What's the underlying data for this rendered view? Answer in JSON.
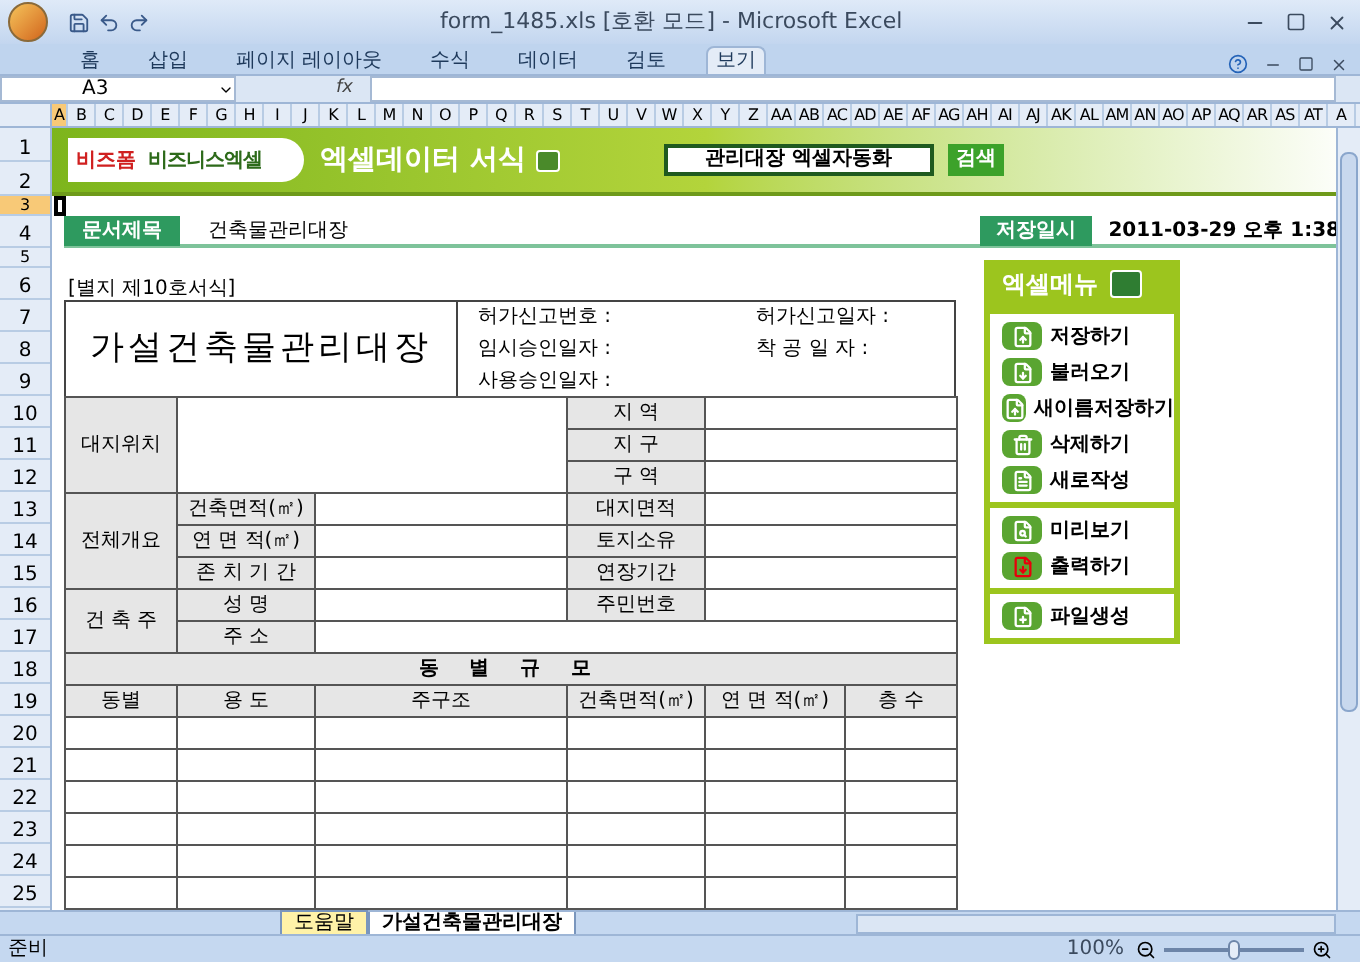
{
  "window": {
    "title": "form_1485.xls  [호환 모드] - Microsoft Excel"
  },
  "ribbon_tabs": [
    {
      "label": "홈",
      "selected": false
    },
    {
      "label": "삽입",
      "selected": false
    },
    {
      "label": "페이지 레이아웃",
      "selected": false
    },
    {
      "label": "수식",
      "selected": false
    },
    {
      "label": "데이터",
      "selected": false
    },
    {
      "label": "검토",
      "selected": false
    },
    {
      "label": "보기",
      "selected": true
    }
  ],
  "formula_bar": {
    "name_box": "A3",
    "fx": "fx"
  },
  "columns": [
    {
      "label": "A",
      "selected": true
    },
    {
      "label": "B",
      "selected": false
    },
    {
      "label": "C",
      "selected": false
    },
    {
      "label": "D",
      "selected": false
    },
    {
      "label": "E",
      "selected": false
    },
    {
      "label": "F",
      "selected": false
    },
    {
      "label": "G",
      "selected": false
    },
    {
      "label": "H",
      "selected": false
    },
    {
      "label": "I",
      "selected": false
    },
    {
      "label": "J",
      "selected": false
    },
    {
      "label": "K",
      "selected": false
    },
    {
      "label": "L",
      "selected": false
    },
    {
      "label": "M",
      "selected": false
    },
    {
      "label": "N",
      "selected": false
    },
    {
      "label": "O",
      "selected": false
    },
    {
      "label": "P",
      "selected": false
    },
    {
      "label": "Q",
      "selected": false
    },
    {
      "label": "R",
      "selected": false
    },
    {
      "label": "S",
      "selected": false
    },
    {
      "label": "T",
      "selected": false
    },
    {
      "label": "U",
      "selected": false
    },
    {
      "label": "V",
      "selected": false
    },
    {
      "label": "W",
      "selected": false
    },
    {
      "label": "X",
      "selected": false
    },
    {
      "label": "Y",
      "selected": false
    },
    {
      "label": "Z",
      "selected": false
    },
    {
      "label": "AA",
      "selected": false
    },
    {
      "label": "AB",
      "selected": false
    },
    {
      "label": "AC",
      "selected": false
    },
    {
      "label": "AD",
      "selected": false
    },
    {
      "label": "AE",
      "selected": false
    },
    {
      "label": "AF",
      "selected": false
    },
    {
      "label": "AG",
      "selected": false
    },
    {
      "label": "AH",
      "selected": false
    },
    {
      "label": "AI",
      "selected": false
    },
    {
      "label": "AJ",
      "selected": false
    },
    {
      "label": "AK",
      "selected": false
    },
    {
      "label": "AL",
      "selected": false
    },
    {
      "label": "AM",
      "selected": false
    },
    {
      "label": "AN",
      "selected": false
    },
    {
      "label": "AO",
      "selected": false
    },
    {
      "label": "AP",
      "selected": false
    },
    {
      "label": "AQ",
      "selected": false
    },
    {
      "label": "AR",
      "selected": false
    },
    {
      "label": "AS",
      "selected": false
    },
    {
      "label": "AT",
      "selected": false
    },
    {
      "label": "A",
      "selected": false
    }
  ],
  "rows": [
    {
      "label": "1",
      "selected": false
    },
    {
      "label": "2",
      "selected": false
    },
    {
      "label": "3",
      "selected": true
    },
    {
      "label": "4",
      "selected": false
    },
    {
      "label": "5",
      "selected": false
    },
    {
      "label": "6",
      "selected": false
    },
    {
      "label": "7",
      "selected": false
    },
    {
      "label": "8",
      "selected": false
    },
    {
      "label": "9",
      "selected": false
    },
    {
      "label": "10",
      "selected": false
    },
    {
      "label": "11",
      "selected": false
    },
    {
      "label": "12",
      "selected": false
    },
    {
      "label": "13",
      "selected": false
    },
    {
      "label": "14",
      "selected": false
    },
    {
      "label": "15",
      "selected": false
    },
    {
      "label": "16",
      "selected": false
    },
    {
      "label": "17",
      "selected": false
    },
    {
      "label": "18",
      "selected": false
    },
    {
      "label": "19",
      "selected": false
    },
    {
      "label": "20",
      "selected": false
    },
    {
      "label": "21",
      "selected": false
    },
    {
      "label": "22",
      "selected": false
    },
    {
      "label": "23",
      "selected": false
    },
    {
      "label": "24",
      "selected": false
    },
    {
      "label": "25",
      "selected": false
    }
  ],
  "banner": {
    "logo": "비즈폼",
    "logo2": "비즈니스엑셀",
    "title": "엑셀데이터 서식",
    "search_value": "관리대장 엑셀자동화",
    "search_button": "검색"
  },
  "doc_header": {
    "title_label": "문서제목",
    "title_value": "건축물관리대장",
    "saved_label": "저장일시",
    "saved_value": "2011-03-29  오후 1:38"
  },
  "form_number": "[별지 제10호서식]",
  "form": {
    "title": "가설건축물관리대장",
    "info": [
      "허가신고번호 :",
      "허가신고일자 :",
      "임시승인일자 :",
      "착 공 일 자 :",
      "사용승인일자 :"
    ],
    "site": {
      "label": "대지위치",
      "fields": [
        "지 역",
        "지 구",
        "구 역"
      ]
    },
    "overview": {
      "label": "전체개요",
      "rows": [
        {
          "left": "건축면적(㎡)",
          "right": "대지면적"
        },
        {
          "left": "연 면 적(㎡)",
          "right": "토지소유"
        },
        {
          "left": "존 치 기 간",
          "right": "연장기간"
        }
      ]
    },
    "owner": {
      "label": "건 축 주",
      "name": "성 명",
      "id": "주민번호",
      "address": "주 소"
    },
    "scale": {
      "title": "동 별 규 모",
      "columns": [
        "동별",
        "용 도",
        "주구조",
        "건축면적(㎡)",
        "연 면 적(㎡)",
        "층 수"
      ]
    }
  },
  "menu": {
    "title": "엑셀메뉴",
    "groups": [
      [
        {
          "label": "저장하기",
          "kind": "save"
        },
        {
          "label": "불러오기",
          "kind": "open"
        },
        {
          "label": "새이름저장하기",
          "kind": "saveas"
        },
        {
          "label": "삭제하기",
          "kind": "delete"
        },
        {
          "label": "새로작성",
          "kind": "new"
        }
      ],
      [
        {
          "label": "미리보기",
          "kind": "preview"
        },
        {
          "label": "출력하기",
          "kind": "print"
        }
      ],
      [
        {
          "label": "파일생성",
          "kind": "file"
        }
      ]
    ]
  },
  "sheet_tabs": [
    {
      "label": "도움말",
      "selected": false,
      "color": "#fff2a8"
    },
    {
      "label": "가설건축물관리대장",
      "selected": true,
      "color": "#ffffff"
    }
  ],
  "status_bar": {
    "text": "준비",
    "zoom": "100%",
    "zoom_slider": {
      "level": 0.5
    }
  }
}
